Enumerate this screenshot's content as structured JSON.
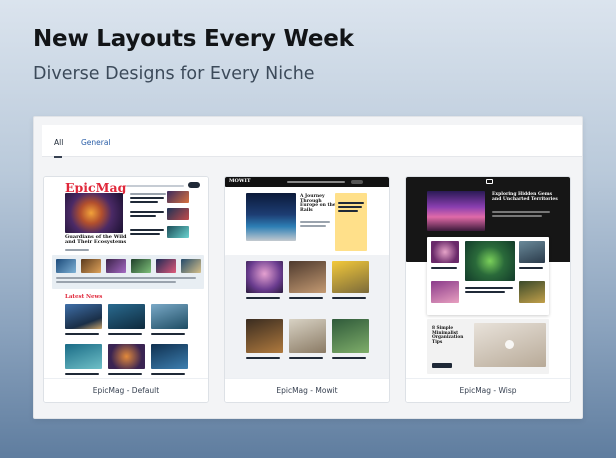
{
  "header": {
    "title": "New Layouts Every Week",
    "subtitle": "Diverse Designs for Every Niche"
  },
  "tabs": [
    {
      "label": "All",
      "active": true
    },
    {
      "label": "General",
      "active": false
    }
  ],
  "cards": [
    {
      "caption": "EpicMag - Default",
      "logo": "EpicMag",
      "headline": "Guardians of the Wild and Their Ecosystems",
      "section": "Latest News"
    },
    {
      "caption": "EpicMag - Mowit",
      "logo": "MOWIT",
      "headline": "A Journey Through Europe on the Rails"
    },
    {
      "caption": "EpicMag - Wisp",
      "headline": "Exploring Hidden Gems and Uncharted Territories",
      "feature": "8 Simple Minimalist Organization Tips"
    }
  ],
  "colors": {
    "accent_red": "#e0273a",
    "tab_link": "#2b5fa8"
  }
}
